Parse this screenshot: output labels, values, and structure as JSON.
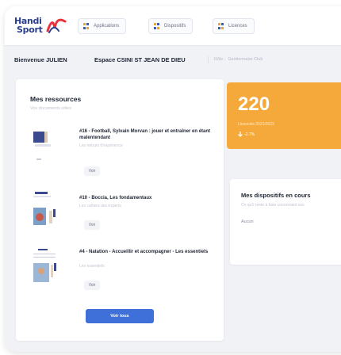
{
  "logo": {
    "line1": "Handi",
    "line2": "Sport"
  },
  "nav": {
    "tabs": [
      {
        "label": "Applications"
      },
      {
        "label": "Dispositifs"
      },
      {
        "label": "Licences"
      }
    ]
  },
  "subheader": {
    "welcome": "Bienvenue JULIEN",
    "space": "Espace CSINI ST JEAN DE DIEU",
    "role_label": "Rôle :",
    "role_value": "Gestionnaire Club"
  },
  "resources": {
    "title": "Mes ressources",
    "subtitle": "Vos documents utiles",
    "items": [
      {
        "title": "#16 - Football, Sylvain Morvan : jouer et entraîner en étant malentendant",
        "subtitle": "Les retours d'expérience",
        "button": "Voir"
      },
      {
        "title": "#10 - Boccia, Les fondamentaux",
        "subtitle": "Les cahiers des experts",
        "button": "Voir"
      },
      {
        "title": "#4 - Natation - Accueillir et accompagner - Les essentiels",
        "subtitle": "Les essentiels",
        "button": "Voir"
      }
    ],
    "view_all": "Voir tous"
  },
  "licences": {
    "count": "220",
    "label": "Licenciés 2021/2022",
    "trend": "-2.7%"
  },
  "dispositifs": {
    "title": "Mes dispositifs en cours",
    "subtitle": "Ce qu'il reste à faire concernant vos",
    "empty": "Aucun"
  },
  "colors": {
    "accent_blue": "#3f6fd8",
    "brand_navy": "#2b3f8c",
    "licence_orange": "#f5a93b"
  }
}
